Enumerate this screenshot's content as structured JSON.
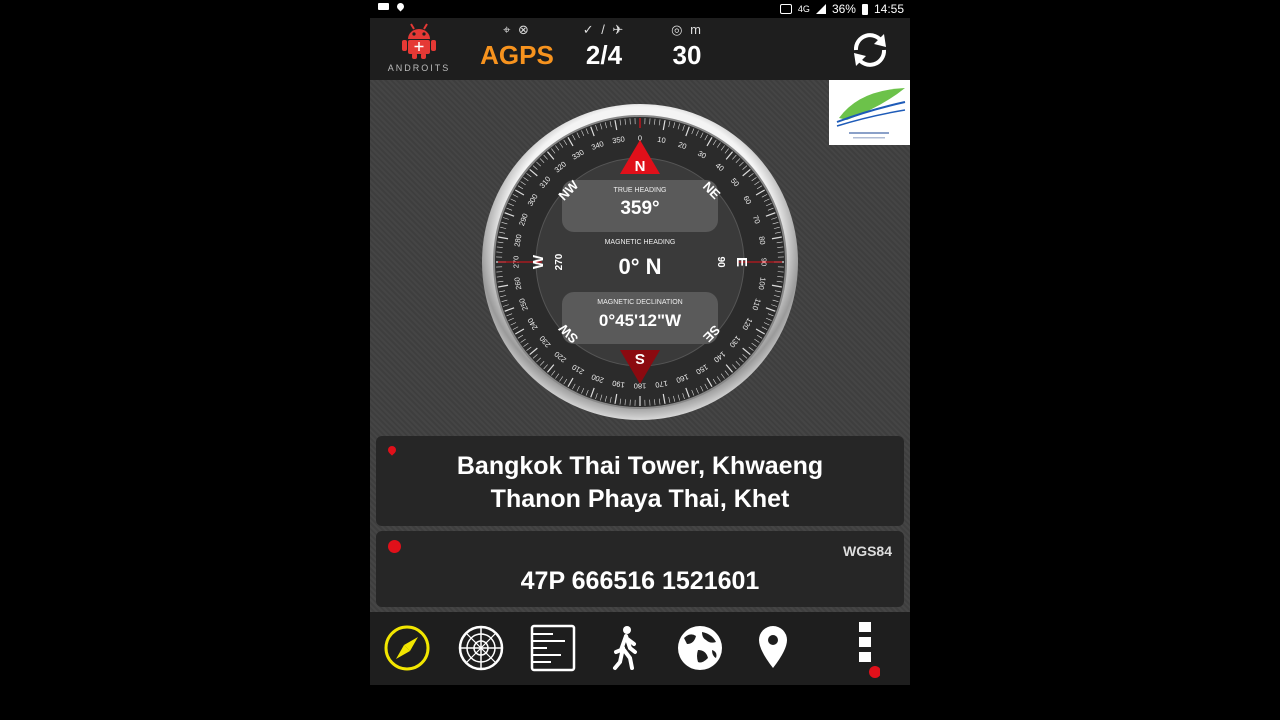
{
  "status_bar": {
    "battery": "36%",
    "time": "14:55",
    "network": "4G"
  },
  "top_bar": {
    "app_logo_text": "ANDROITS",
    "fix_mode": "AGPS",
    "satellites": "2/4",
    "accuracy_unit": "m",
    "accuracy": "30",
    "colors": {
      "agps": "#f7931e",
      "logo": "#e53935"
    }
  },
  "compass": {
    "true_heading_label": "TRUE HEADING",
    "true_heading": "359°",
    "magnetic_heading_label": "MAGNETIC HEADING",
    "magnetic_heading": "0° N",
    "magnetic_declination_label": "MAGNETIC DECLINATION",
    "magnetic_declination": "0°45'12\"W",
    "cardinals": {
      "n": "N",
      "s": "S",
      "e": "E",
      "w": "W",
      "ne": "NE",
      "nw": "NW",
      "se": "SE",
      "sw": "SW"
    },
    "side_labels": {
      "west": "270",
      "east": "90"
    },
    "accent_color": "#e0101a"
  },
  "location": {
    "line1": "Bangkok Thai Tower, Khwaeng",
    "line2": "Thanon Phaya Thai, Khet"
  },
  "coordinates": {
    "datum": "WGS84",
    "value": "47P 666516 1521601"
  },
  "bottom_nav": {
    "items": [
      "compass-icon",
      "radar-icon",
      "ruler-icon",
      "walker-icon",
      "globe-icon",
      "pin-icon",
      "more-icon"
    ],
    "active_color": "#f2e600"
  }
}
